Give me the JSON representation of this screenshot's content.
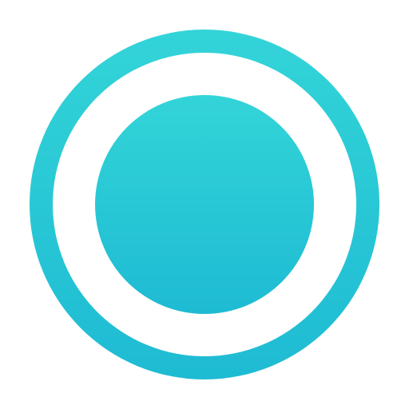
{
  "icon": {
    "name": "record-icon",
    "colors": {
      "background": "#ffffff",
      "gradient_top": "#33d4d8",
      "gradient_bottom": "#1ebbd3",
      "ring_gap": "#ffffff"
    }
  }
}
